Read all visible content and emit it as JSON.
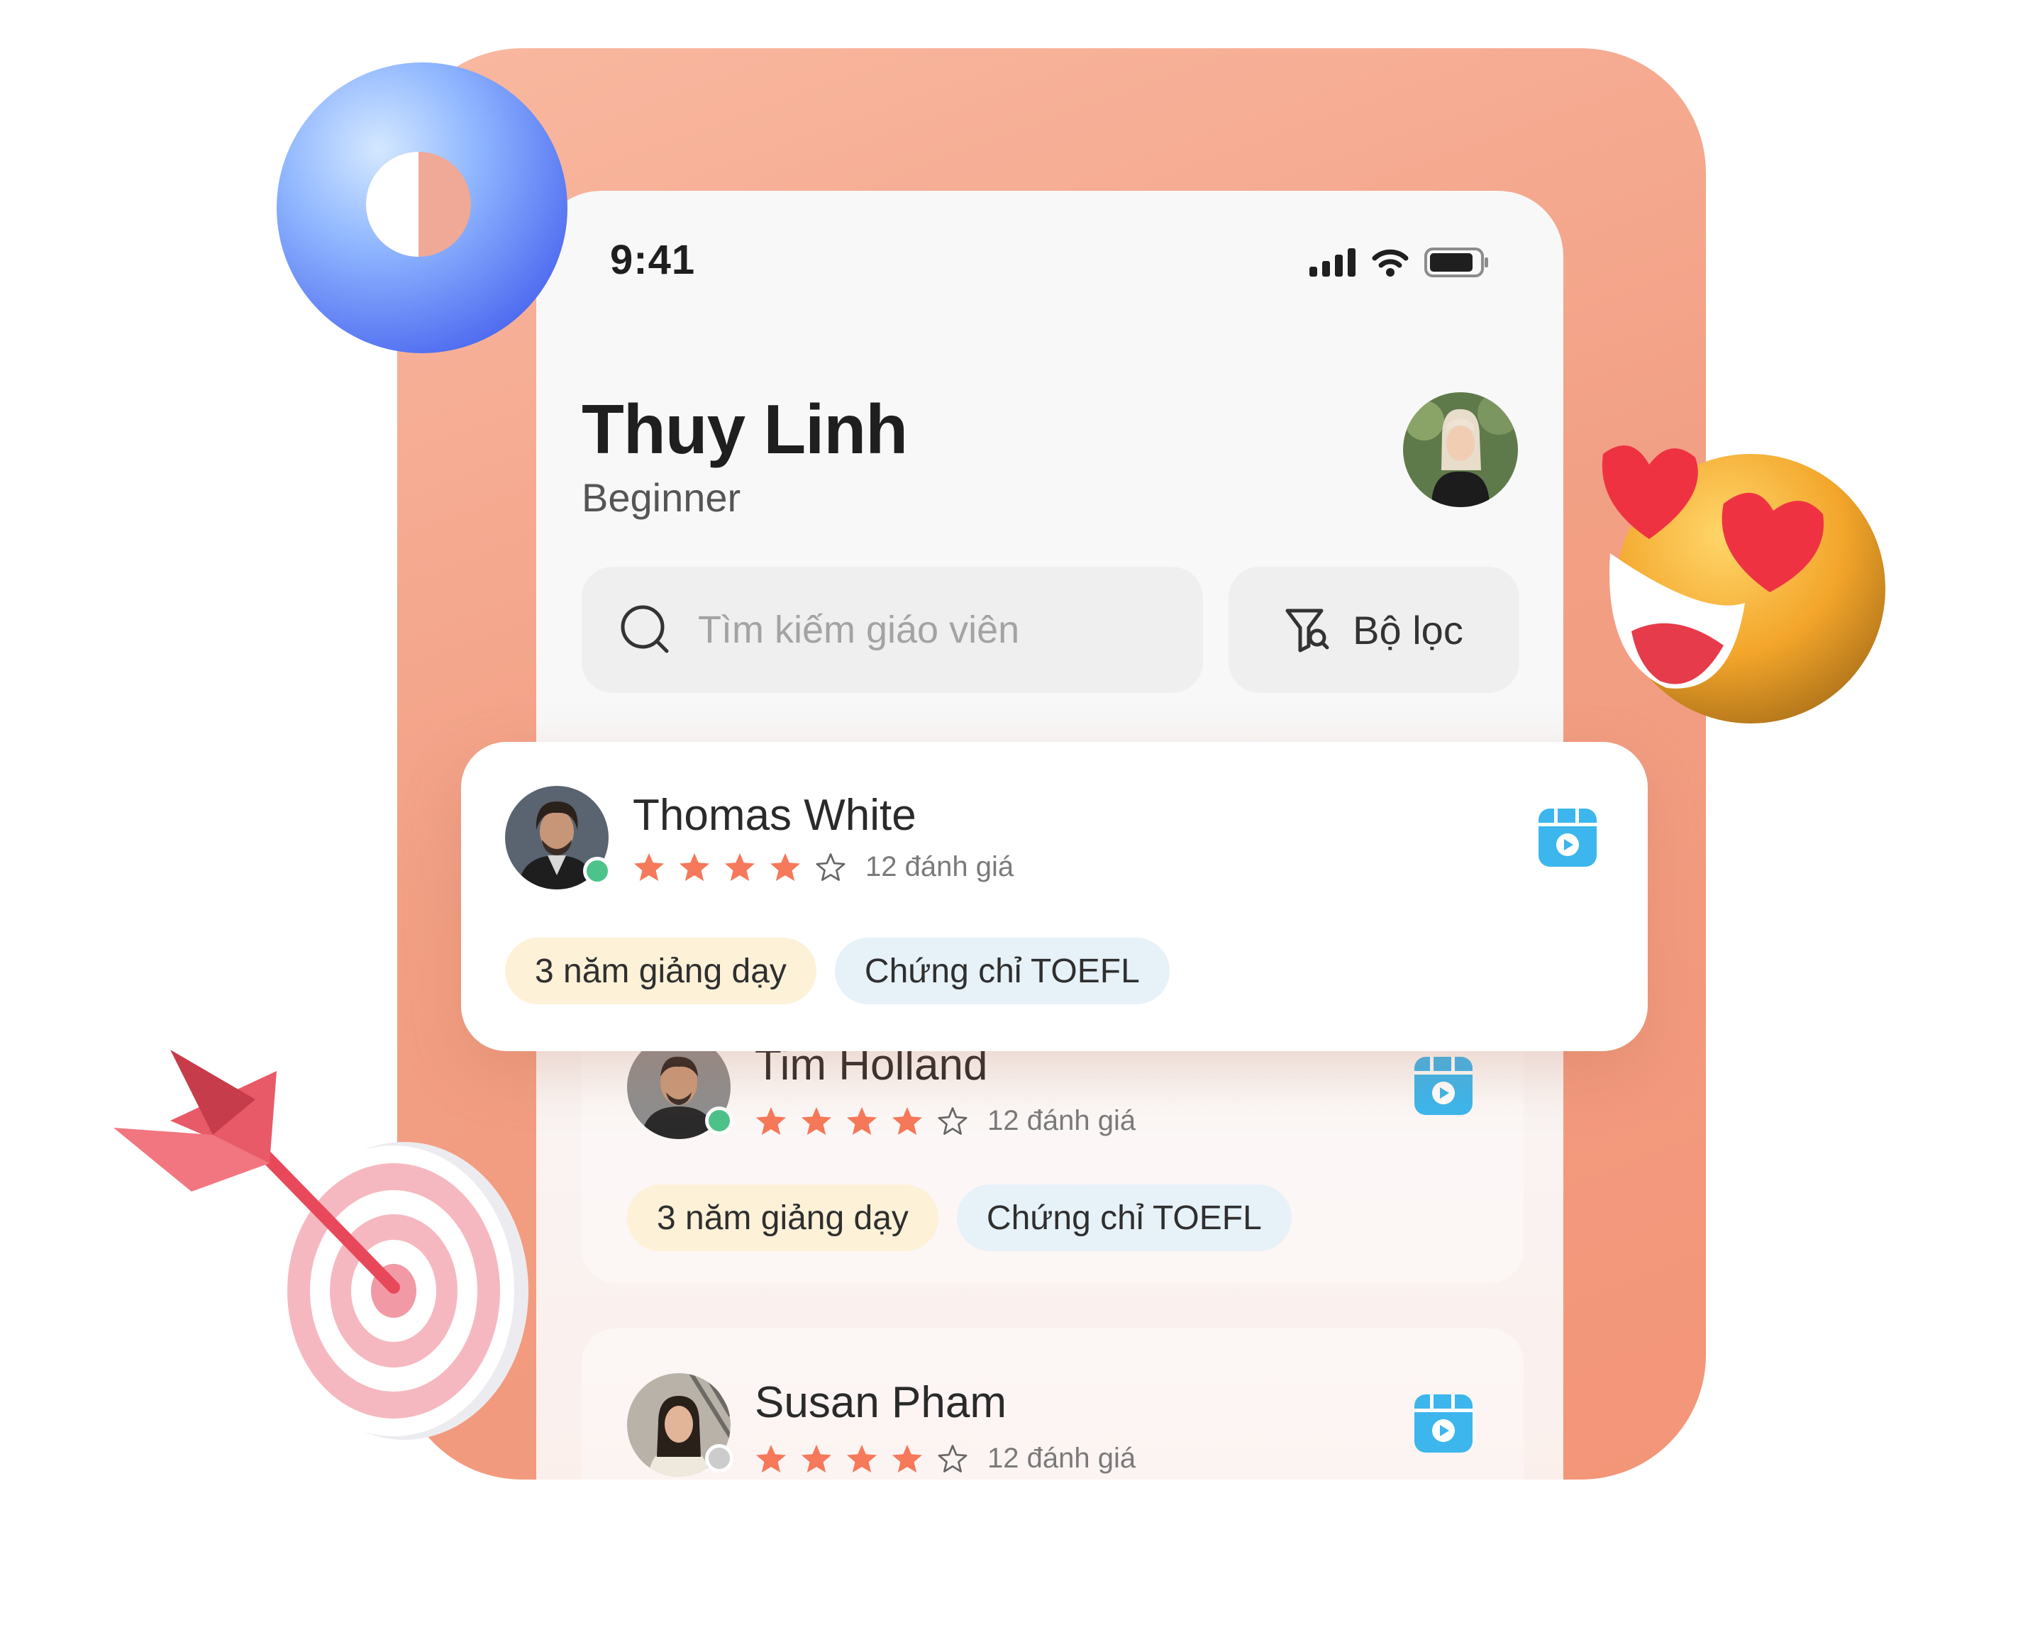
{
  "status_bar": {
    "time": "9:41"
  },
  "user": {
    "name": "Thuy Linh",
    "level": "Beginner"
  },
  "search": {
    "placeholder": "Tìm kiếm giáo viên"
  },
  "filter": {
    "label": "Bộ lọc"
  },
  "teachers": [
    {
      "name": "Thomas White",
      "rating": 4,
      "max_rating": 5,
      "reviews": "12 đánh giá",
      "online": true,
      "tags": [
        "3 năm giảng dạy",
        "Chứng chỉ TOEFL"
      ]
    },
    {
      "name": "Tim Holland",
      "rating": 4,
      "max_rating": 5,
      "reviews": "12 đánh giá",
      "online": true,
      "tags": [
        "3 năm giảng dạy",
        "Chứng chỉ TOEFL"
      ]
    },
    {
      "name": "Susan Pham",
      "rating": 4,
      "max_rating": 5,
      "reviews": "12 đánh giá",
      "online": false,
      "tags": []
    }
  ],
  "icons": [
    "signal-icon",
    "wifi-icon",
    "battery-icon",
    "search-icon",
    "filter-icon",
    "video-icon",
    "star-icon"
  ],
  "colors": {
    "accent": "#f59f81",
    "star": "#f5795a",
    "video": "#3cb6ec",
    "online": "#4cc38a",
    "offline": "#cccccc"
  }
}
